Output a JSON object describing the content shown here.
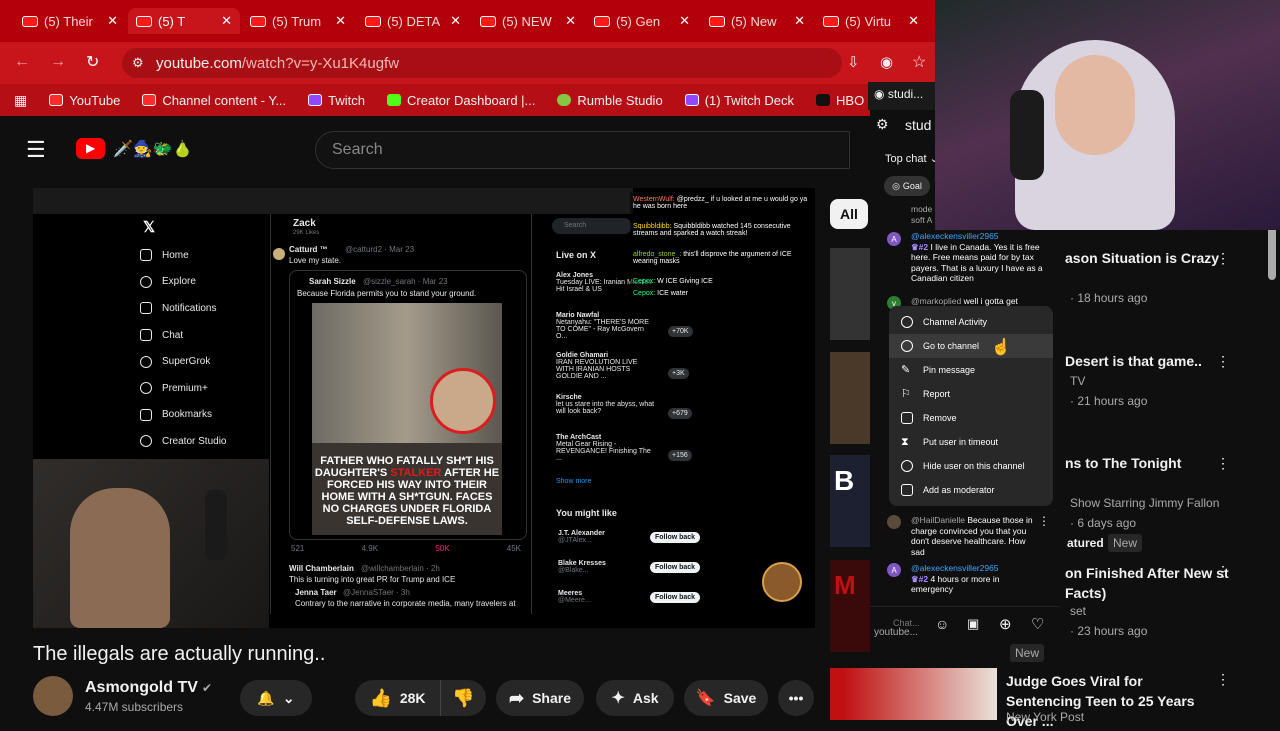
{
  "browser": {
    "tabs": [
      {
        "label": "(5) Their"
      },
      {
        "label": "(5) T"
      },
      {
        "label": "(5) Trum"
      },
      {
        "label": "(5) DETA"
      },
      {
        "label": "(5) NEW"
      },
      {
        "label": "(5) Gen"
      },
      {
        "label": "(5) New"
      },
      {
        "label": "(5) Virtu"
      }
    ],
    "url_host": "youtube.com",
    "url_path": "/watch?v=y-Xu1K4ugfw",
    "bookmarks": [
      "YouTube",
      "Channel content - Y...",
      "Twitch",
      "Creator Dashboard |...",
      "Rumble Studio",
      "(1) Twitch Deck",
      "HBO Max",
      "studi..."
    ]
  },
  "youtube": {
    "search_placeholder": "Search",
    "emoji_text": "🗡️🧙🐲🍐",
    "video_title": "The illegals are actually running..",
    "channel_name": "Asmongold TV",
    "subscribers": "4.47M subscribers",
    "likes": "28K",
    "share_label": "Share",
    "ask_label": "Ask",
    "save_label": "Save",
    "chip_all": "All"
  },
  "video_content": {
    "x_nav": [
      "Home",
      "Explore",
      "Notifications",
      "Chat",
      "SuperGrok",
      "Premium+",
      "Bookmarks",
      "Creator Studio"
    ],
    "profile_name": "Zack",
    "profile_posts": "29K Likes",
    "post1_author": "Catturd ™",
    "post1_handle": "@catturd2 · Mar 23",
    "post1_text": "Love my state.",
    "quote_author": "Sarah Sizzle",
    "quote_handle": "@sizzle_sarah · Mar 23",
    "quote_text": "Because Florida permits you to stand your ground.",
    "headline_a": "FATHER WHO FATALLY SH*T HIS DAUGHTER'S",
    "headline_red": "STALKER",
    "headline_b": "AFTER HE FORCED HIS WAY INTO THEIR HOME WITH A SH*TGUN. FACES NO CHARGES UNDER FLORIDA SELF-DEFENSE LAWS.",
    "stats": [
      "521",
      "4.9K",
      "50K",
      "45K"
    ],
    "post2_author": "Will Chamberlain",
    "post2_handle": "@willchamberlain · 2h",
    "post2_text": "This is turning into great PR for Trump and ICE",
    "post3_author": "Jenna Taer",
    "post3_handle": "@JennaSTaer · 3h",
    "post3_text": "Contrary to the narrative in corporate media, many travelers at",
    "live_search": "Search",
    "live_header": "Live on X",
    "live_items": [
      {
        "name": "Alex Jones",
        "title": "Tuesday LIVE: Iranian Missiles Hit Israel & US"
      },
      {
        "name": "Mario Nawfal",
        "title": "Netanyahu: \"THERE'S MORE TO COME\" - Ray McGovern O..."
      },
      {
        "name": "Goldie Ghamari",
        "title": "IRAN REVOLUTION LIVE WITH IRANIAN HOSTS GOLDIE AND ..."
      },
      {
        "name": "Kirsche",
        "title": "let us stare into the abyss, what will look back?"
      },
      {
        "name": "The ArchCast",
        "title": "Metal Gear Rising - REVENGANCE! Finishing The ..."
      }
    ],
    "live_counts": [
      "+70K",
      "+3K",
      "+679",
      "+156"
    ],
    "show_more": "Show more",
    "might_like": "You might like",
    "follow_list": [
      {
        "name": "J.T. Alexander",
        "handle": "@JTAlex..."
      },
      {
        "name": "Blake Kresses",
        "handle": "@Blake..."
      },
      {
        "name": "Meeres",
        "handle": "@Meere..."
      }
    ],
    "follow_back": "Follow back",
    "overlay_chat": [
      {
        "user": "WesternWulf:",
        "text": "@predzz_ if u looked at me u would go ya he was born here"
      },
      {
        "user": "Squibbldibb:",
        "text": "Squibbldibb watched 145 consecutive streams and sparked a watch streak!"
      },
      {
        "user": "alfredo_stone_:",
        "text": "this'll disprove the argument of ICE wearing masks"
      },
      {
        "user": "Cepox:",
        "text": "W ICE Giving ICE"
      },
      {
        "user": "Cepox:",
        "text": "ICE water"
      }
    ]
  },
  "chat": {
    "header_title": "stud",
    "top_chat": "Top chat",
    "goal_label": "Goal",
    "msg_partial": "mode soft A",
    "msg1_user": "@alexeckensviller2965",
    "msg1_badge": "#2",
    "msg1_text": "I live in Canada. Yes it is free here. Free means paid for by tax payers. That is a luxury I have as a Canadian citizen",
    "msg2_user": "@markoplied",
    "msg2_text": "well i gotta get",
    "msg3_user": "@HailDanielle",
    "msg3_text": "Because those in charge convinced you that you don't deserve healthcare. How sad",
    "msg4_user": "@alexeckensviller2965",
    "msg4_badge": "#2",
    "msg4_text": "4 hours or more in emergency",
    "input_placeholder": "Chat...",
    "input_source": "youtube...",
    "menu": [
      "Channel Activity",
      "Go to channel",
      "Pin message",
      "Report",
      "Remove",
      "Put user in timeout",
      "Hide user on this channel",
      "Add as moderator"
    ],
    "menu_icons": [
      "history-icon",
      "person-icon",
      "pin-icon",
      "flag-icon",
      "trash-icon",
      "hourglass-icon",
      "hide-icon",
      "add-moderator-icon"
    ]
  },
  "recommendations": [
    {
      "title": "ason Situation is Crazy",
      "sub": "18 hours ago"
    },
    {
      "title": "Desert is that game..",
      "sub": "21 hours ago",
      "channel": "TV"
    },
    {
      "title": "ns to The Tonight",
      "sub": "6 days ago",
      "channel": "Show Starring Jimmy Fallon",
      "extra": "atured",
      "badge": "New"
    },
    {
      "title": "on Finished After New st Facts)",
      "sub": "23 hours ago",
      "channel": "set",
      "badge": "New"
    },
    {
      "title": "Judge Goes Viral for Sentencing Teen to 25 Years Over ...",
      "sub": "New York Post"
    }
  ],
  "colors": {
    "accent": "#ff0000",
    "browser_red": "#c8151b",
    "link_blue": "#3ea6ff"
  }
}
